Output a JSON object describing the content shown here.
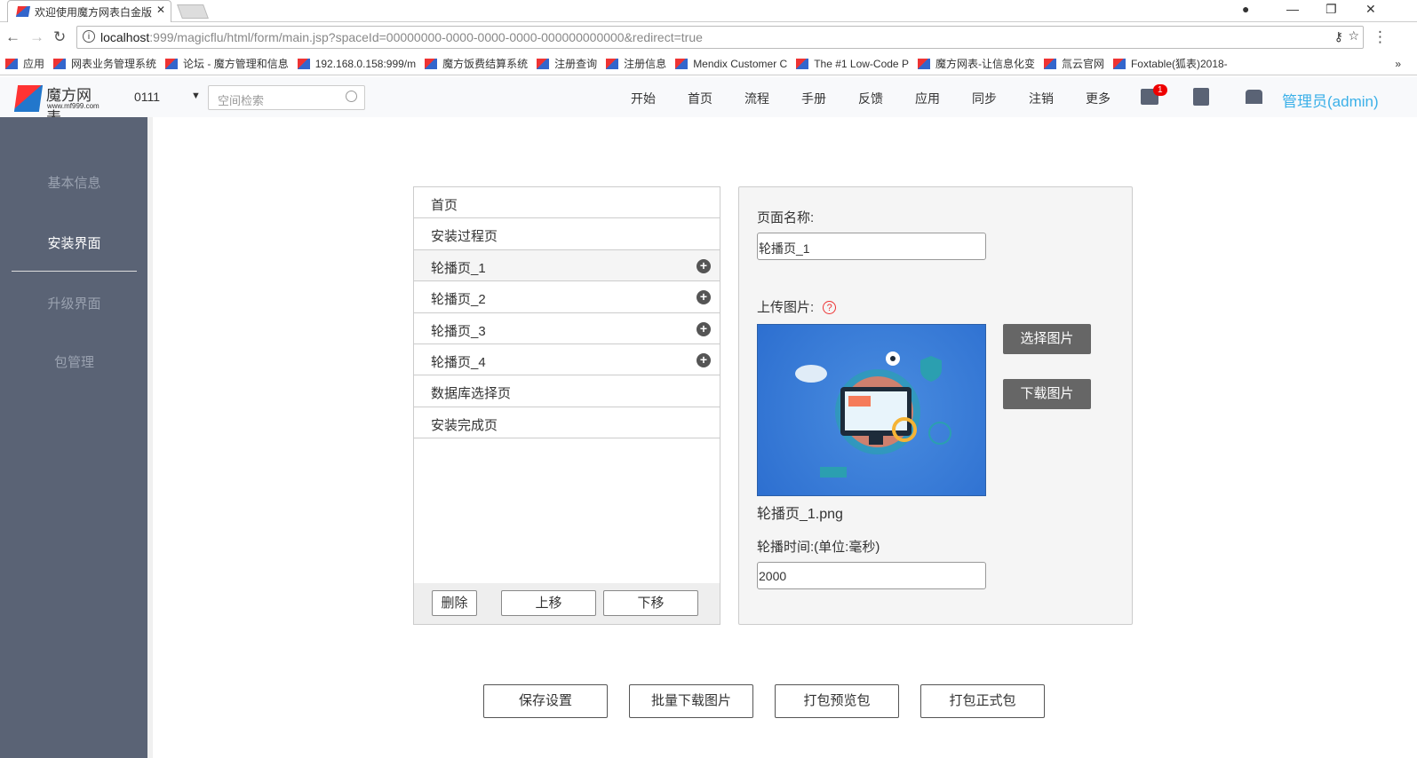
{
  "browser": {
    "tab_title": "欢迎使用魔方网表白金版",
    "url_host": "localhost",
    "url_rest": ":999/magicflu/html/form/main.jsp?spaceId=00000000-0000-0000-0000-000000000000&redirect=true",
    "bookmarks": [
      "应用",
      "网表业务管理系统",
      "论坛 - 魔方管理和信息",
      "192.168.0.158:999/m",
      "魔方饭费结算系统",
      "注册查询",
      "注册信息",
      "Mendix Customer C",
      "The #1 Low-Code P",
      "魔方网表-让信息化变",
      "氚云官网",
      "Foxtable(狐表)2018-"
    ],
    "more": "»"
  },
  "header": {
    "logo_title": "魔方网表",
    "logo_url": "www.mf999.com",
    "space": "0111",
    "search_placeholder": "空间检索",
    "menu": [
      "开始",
      "首页",
      "流程",
      "手册",
      "反馈",
      "应用",
      "同步",
      "注销",
      "更多"
    ],
    "mail_badge": "1",
    "user": "管理员(admin)"
  },
  "sidebar": {
    "items": [
      "基本信息",
      "安装界面",
      "升级界面",
      "包管理"
    ],
    "active": 1
  },
  "pages": {
    "items": [
      {
        "label": "首页",
        "plus": false
      },
      {
        "label": "安装过程页",
        "plus": false
      },
      {
        "label": "轮播页_1",
        "plus": true
      },
      {
        "label": "轮播页_2",
        "plus": true
      },
      {
        "label": "轮播页_3",
        "plus": true
      },
      {
        "label": "轮播页_4",
        "plus": true
      },
      {
        "label": "数据库选择页",
        "plus": false
      },
      {
        "label": "安装完成页",
        "plus": false
      }
    ],
    "delete": "删除",
    "up": "上移",
    "down": "下移"
  },
  "detail": {
    "name_label": "页面名称:",
    "name_value": "轮播页_1",
    "upload_label": "上传图片:",
    "help": "?",
    "choose": "选择图片",
    "download": "下载图片",
    "filename": "轮播页_1.png",
    "interval_label": "轮播时间:(单位:毫秒)",
    "interval_value": "2000"
  },
  "actions": [
    "保存设置",
    "批量下载图片",
    "打包预览包",
    "打包正式包"
  ]
}
